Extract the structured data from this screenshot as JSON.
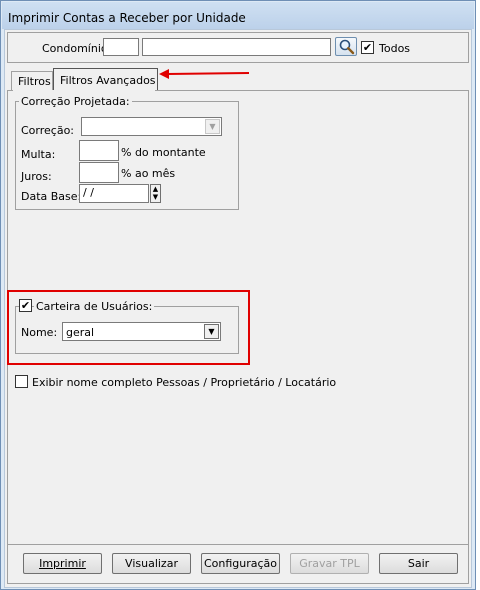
{
  "window": {
    "title": "Imprimir Contas a Receber por Unidade"
  },
  "condominio": {
    "label": "Condomínio:",
    "code_value": "",
    "name_value": "",
    "todos_label": "Todos",
    "todos_checked": "✔"
  },
  "tabs": [
    {
      "label": "Filtros",
      "active": false
    },
    {
      "label": "Filtros Avançados",
      "active": true
    }
  ],
  "correcao_group": {
    "title": "Correção Projetada:",
    "correcao_label": "Correção:",
    "correcao_value": "",
    "multa_label": "Multa:",
    "multa_value": "",
    "multa_unit": "% do montante",
    "juros_label": "Juros:",
    "juros_value": "",
    "juros_unit": "% ao mês",
    "data_base_label": "Data Base:",
    "data_base_value": " /  /"
  },
  "carteira_group": {
    "title": "Carteira de Usuários:",
    "checked": "✔",
    "nome_label": "Nome:",
    "nome_value": "geral"
  },
  "exibir_nome": {
    "label": "Exibir nome completo Pessoas / Proprietário / Locatário",
    "checked": ""
  },
  "buttons": {
    "imprimir": "Imprimir",
    "visualizar": "Visualizar",
    "configuracao": "Configuração",
    "gravar_tpl": "Gravar TPL",
    "sair": "Sair"
  },
  "annotation_color": "#e00000"
}
